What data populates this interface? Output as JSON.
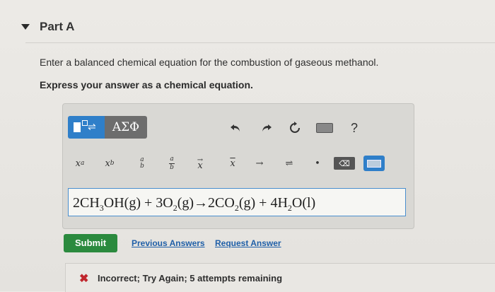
{
  "part": {
    "title": "Part A"
  },
  "question": {
    "prompt": "Enter a balanced chemical equation for the combustion of gaseous methanol.",
    "instruction": "Express your answer as a chemical equation."
  },
  "toolbar": {
    "greek_label": "ΑΣΦ",
    "help_label": "?"
  },
  "answer": {
    "segments": [
      "2CH",
      "3",
      "OH(g) + 3O",
      "2",
      "(g)→2CO",
      "2",
      "(g) + 4H",
      "2",
      "O(l)"
    ]
  },
  "actions": {
    "submit_label": "Submit",
    "previous_label": "Previous Answers",
    "request_label": "Request Answer"
  },
  "feedback": {
    "icon": "✖",
    "text": "Incorrect; Try Again; 5 attempts remaining"
  },
  "colors": {
    "submit": "#2b8a3e",
    "link": "#1f5fa8",
    "error": "#c0262d",
    "template_button": "#2f7fc9"
  }
}
